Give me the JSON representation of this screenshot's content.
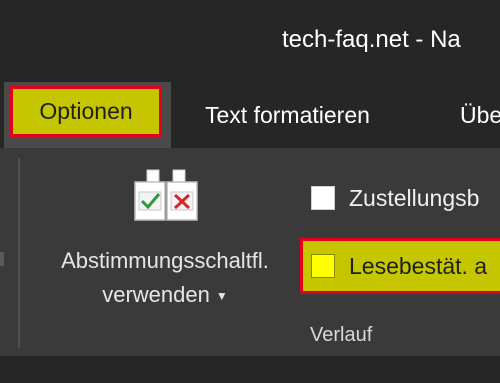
{
  "window": {
    "title": "tech-faq.net  -  Na"
  },
  "tabs": [
    {
      "label": "Optionen",
      "active": true
    },
    {
      "label": "Text formatieren",
      "active": false
    },
    {
      "label": "Übe",
      "active": false
    }
  ],
  "voting": {
    "label_line1": "Abstimmungsschaltfl.",
    "label_line2": "verwenden",
    "icon": "voting-buttons-icon"
  },
  "tracking": {
    "delivery_label": "Zustellungsb",
    "delivery_checked": false,
    "read_label": "Lesebestät. a",
    "read_checked": false,
    "group_label": "Verlauf"
  },
  "colors": {
    "highlight_fill": "#c6c600",
    "highlight_border": "#e3001b",
    "ribbon_bg": "#3a3a3a",
    "title_bg": "#262626"
  }
}
